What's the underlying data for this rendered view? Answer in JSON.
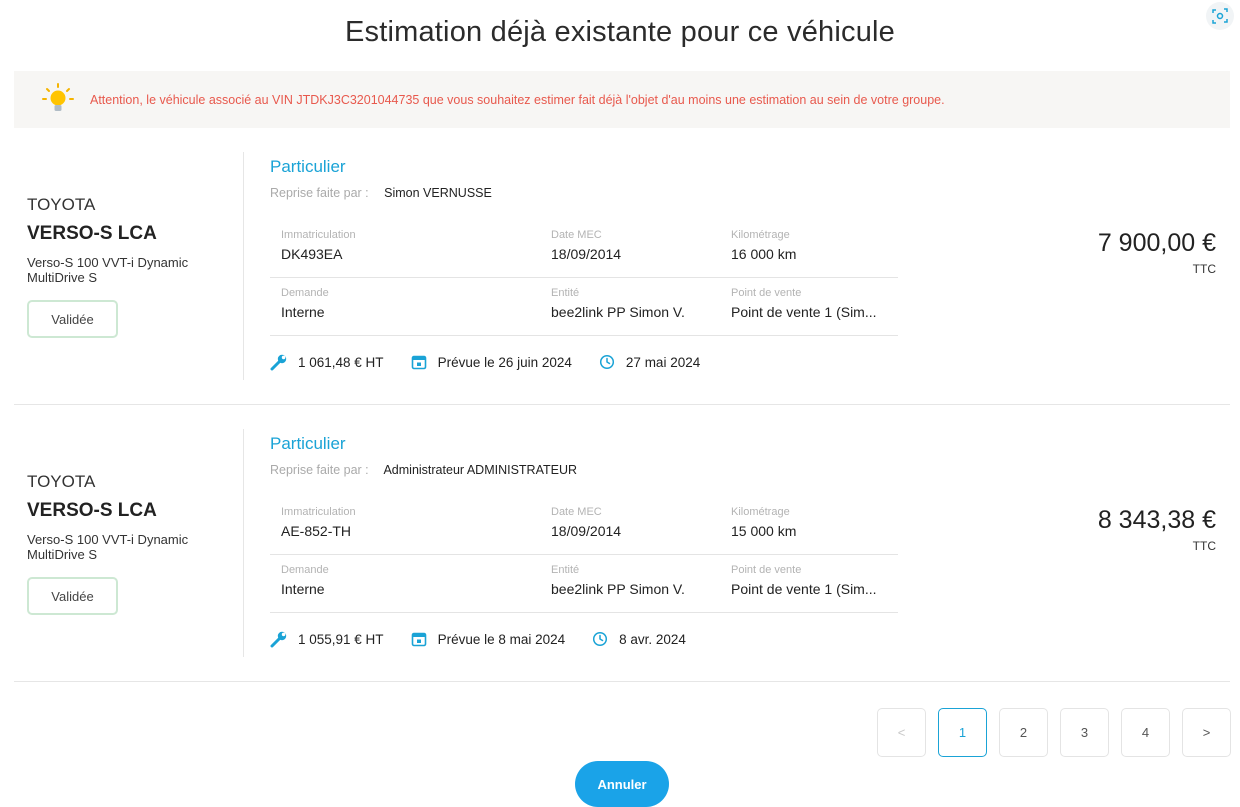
{
  "dialog": {
    "title": "Estimation déjà existante pour ce véhicule",
    "warning": "Attention, le véhicule associé au VIN JTDKJ3C3201044735 que vous souhaitez estimer fait déjà l'objet d'au moins une estimation au sein de votre groupe.",
    "cancel_label": "Annuler",
    "accent_color": "#1aa3d6",
    "warning_color": "#e8594d"
  },
  "labels": {
    "reprise": "Reprise faite par :",
    "immatriculation": "Immatriculation",
    "date_mec": "Date MEC",
    "kilometrage": "Kilométrage",
    "demande": "Demande",
    "entite": "Entité",
    "point_de_vente": "Point de vente",
    "ttc": "TTC"
  },
  "estimations": [
    {
      "brand": "TOYOTA",
      "model": "VERSO-S LCA",
      "version": "Verso-S 100 VVT-i Dynamic MultiDrive S",
      "status": "Validée",
      "type": "Particulier",
      "reprise_par": "Simon VERNUSSE",
      "immatriculation": "DK493EA",
      "date_mec": "18/09/2014",
      "kilometrage": "16 000 km",
      "demande": "Interne",
      "entite": "bee2link PP Simon V.",
      "point_de_vente": "Point de vente 1 (Sim...",
      "frais": "1 061,48 € HT",
      "prevue": "Prévue le 26 juin 2024",
      "date": "27 mai 2024",
      "price": "7 900,00 €"
    },
    {
      "brand": "TOYOTA",
      "model": "VERSO-S LCA",
      "version": "Verso-S 100 VVT-i Dynamic MultiDrive S",
      "status": "Validée",
      "type": "Particulier",
      "reprise_par": "Administrateur ADMINISTRATEUR",
      "immatriculation": "AE-852-TH",
      "date_mec": "18/09/2014",
      "kilometrage": "15 000 km",
      "demande": "Interne",
      "entite": "bee2link PP Simon V.",
      "point_de_vente": "Point de vente 1 (Sim...",
      "frais": "1 055,91 € HT",
      "prevue": "Prévue le 8 mai 2024",
      "date": "8 avr. 2024",
      "price": "8 343,38 €"
    }
  ],
  "pagination": {
    "prev": "<",
    "pages": [
      "1",
      "2",
      "3",
      "4"
    ],
    "current": "1",
    "next": ">"
  },
  "icons": {
    "corner": "focus-scan-icon",
    "alert": "lightbulb-icon",
    "frais": "wrench-icon",
    "prevue": "calendar-icon",
    "date": "clock-icon"
  }
}
